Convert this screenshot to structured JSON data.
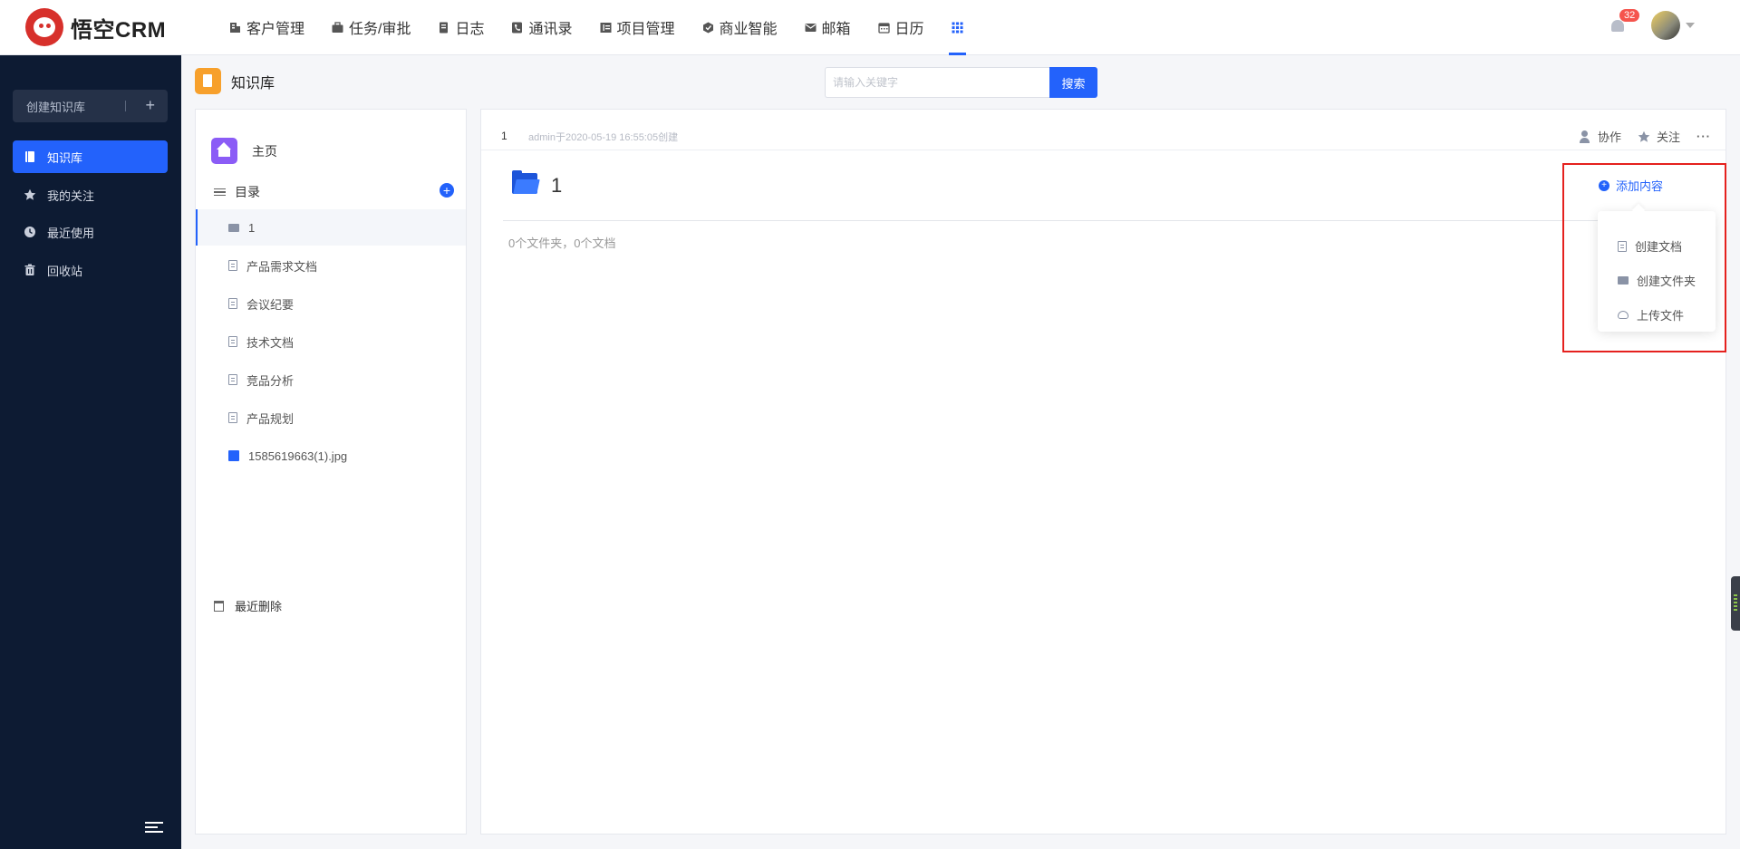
{
  "app": {
    "brand": "悟空CRM",
    "notifications_count": "32",
    "brand_color": "#2362fb"
  },
  "nav": {
    "items": [
      {
        "label": "客户管理",
        "icon": "building-icon"
      },
      {
        "label": "任务/审批",
        "icon": "briefcase-icon"
      },
      {
        "label": "日志",
        "icon": "log-icon"
      },
      {
        "label": "通讯录",
        "icon": "phone-book-icon"
      },
      {
        "label": "项目管理",
        "icon": "project-icon"
      },
      {
        "label": "商业智能",
        "icon": "bi-icon"
      },
      {
        "label": "邮箱",
        "icon": "mail-icon"
      },
      {
        "label": "日历",
        "icon": "calendar-icon"
      }
    ],
    "apps_icon": "grid-apps-icon"
  },
  "sidebar": {
    "create_label": "创建知识库",
    "items": [
      {
        "label": "知识库",
        "icon": "book-icon",
        "active": true
      },
      {
        "label": "我的关注",
        "icon": "star-icon"
      },
      {
        "label": "最近使用",
        "icon": "clock-icon"
      },
      {
        "label": "回收站",
        "icon": "trash-icon"
      }
    ]
  },
  "header": {
    "title": "知识库",
    "search_placeholder": "请输入关键字",
    "search_button": "搜索"
  },
  "tree": {
    "home": "主页",
    "toc": "目录",
    "items": [
      {
        "label": "1",
        "type": "folder",
        "selected": true
      },
      {
        "label": "产品需求文档",
        "type": "doc"
      },
      {
        "label": "会议纪要",
        "type": "doc"
      },
      {
        "label": "技术文档",
        "type": "doc"
      },
      {
        "label": "竞品分析",
        "type": "doc"
      },
      {
        "label": "产品规划",
        "type": "doc"
      },
      {
        "label": "1585619663(1).jpg",
        "type": "image"
      }
    ],
    "recent_deleted": "最近删除"
  },
  "main": {
    "name": "1",
    "meta": "admin于2020-05-19 16:55:05创建",
    "actions": {
      "collab": "协作",
      "follow": "关注",
      "more": "···"
    },
    "folder_title": "1",
    "stats": "0个文件夹，0个文档",
    "add_content": "添加内容",
    "dropdown": [
      {
        "label": "创建文档",
        "icon": "doc-icon"
      },
      {
        "label": "创建文件夹",
        "icon": "folder-icon"
      },
      {
        "label": "上传文件",
        "icon": "cloud-upload-icon"
      }
    ]
  }
}
